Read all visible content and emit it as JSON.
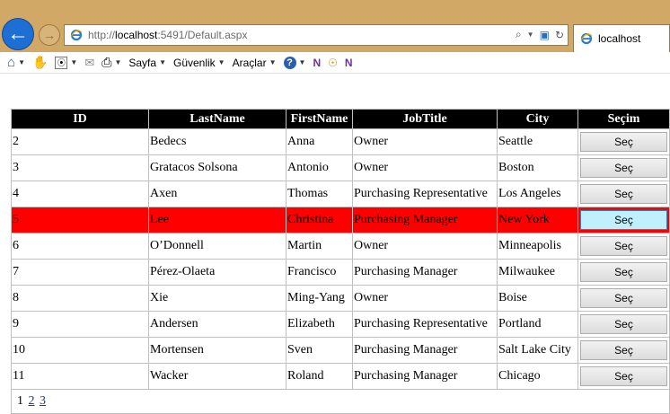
{
  "browser": {
    "url_prefix": "http://",
    "url_host": "localhost",
    "url_rest": ":5491/Default.aspx",
    "tab_title": "localhost"
  },
  "command_bar": {
    "items": [
      "Sayfa",
      "Güvenlik",
      "Araçlar"
    ]
  },
  "grid": {
    "headers": [
      "ID",
      "LastName",
      "FirstName",
      "JobTitle",
      "City",
      "Seçim"
    ],
    "select_label": "Seç",
    "rows": [
      {
        "id": "2",
        "last": "Bedecs",
        "first": "Anna",
        "job": "Owner",
        "city": "Seattle"
      },
      {
        "id": "3",
        "last": "Gratacos Solsona",
        "first": "Antonio",
        "job": "Owner",
        "city": "Boston"
      },
      {
        "id": "4",
        "last": "Axen",
        "first": "Thomas",
        "job": "Purchasing Representative",
        "city": "Los Angeles"
      },
      {
        "id": "5",
        "last": "Lee",
        "first": "Christina",
        "job": "Purchasing Manager",
        "city": "New York"
      },
      {
        "id": "6",
        "last": "O’Donnell",
        "first": "Martin",
        "job": "Owner",
        "city": "Minneapolis"
      },
      {
        "id": "7",
        "last": "Pérez-Olaeta",
        "first": "Francisco",
        "job": "Purchasing Manager",
        "city": "Milwaukee"
      },
      {
        "id": "8",
        "last": "Xie",
        "first": "Ming-Yang",
        "job": "Owner",
        "city": "Boise"
      },
      {
        "id": "9",
        "last": "Andersen",
        "first": "Elizabeth",
        "job": "Purchasing Representative",
        "city": "Portland"
      },
      {
        "id": "10",
        "last": "Mortensen",
        "first": "Sven",
        "job": "Purchasing Manager",
        "city": "Salt Lake City"
      },
      {
        "id": "11",
        "last": "Wacker",
        "first": "Roland",
        "job": "Purchasing Manager",
        "city": "Chicago"
      }
    ],
    "selected_index": 3,
    "selected_color": "#ff0000",
    "pager": {
      "current": "1",
      "pages": [
        "2",
        "3"
      ]
    }
  }
}
